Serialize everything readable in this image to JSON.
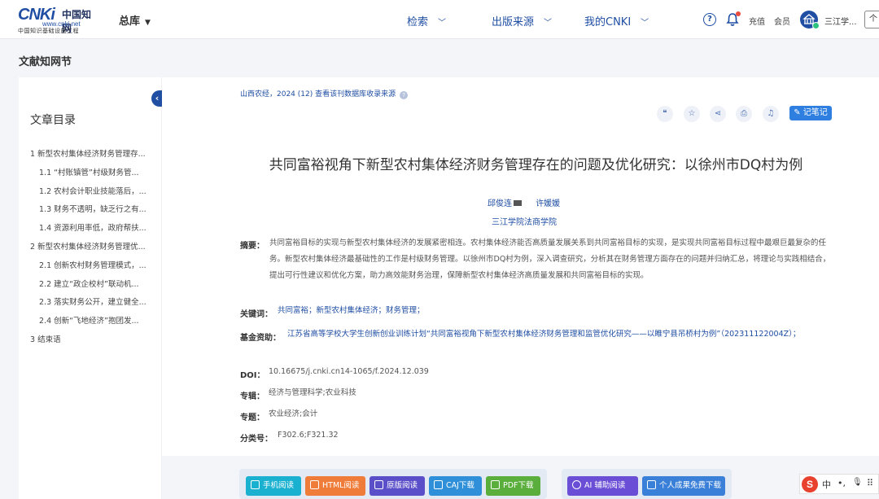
{
  "header": {
    "logo_text": "CNKi",
    "logo_cn": "中国知网",
    "logo_url": "www.cnki.net",
    "logo_sub": "中国知识基础设施工程",
    "zongku": "总库",
    "nav": [
      "检索",
      "出版来源",
      "我的CNKI"
    ],
    "help": "?",
    "recharge": "充值",
    "member": "会员",
    "username": "三江学...",
    "box": "个"
  },
  "section_title": "文献知网节",
  "toc": {
    "title": "文章目录",
    "items": [
      {
        "label": "1 新型农村集体经济财务管理存...",
        "level": 1
      },
      {
        "label": "1.1 “村账镇管”村级财务管...",
        "level": 2
      },
      {
        "label": "1.2 农村会计职业技能落后，...",
        "level": 2
      },
      {
        "label": "1.3 财务不透明，缺乏行之有...",
        "level": 2
      },
      {
        "label": "1.4 资源利用率低，政府帮扶...",
        "level": 2
      },
      {
        "label": "2 新型农村集体经济财务管理优...",
        "level": 1
      },
      {
        "label": "2.1 创新农村财务管理模式，...",
        "level": 2
      },
      {
        "label": "2.2 建立“政企校村”联动机...",
        "level": 2
      },
      {
        "label": "2.3 落实财务公开，建立健全...",
        "level": 2
      },
      {
        "label": "2.4 创新“飞地经济”抱团发...",
        "level": 2
      },
      {
        "label": "3 结束语",
        "level": 1
      }
    ]
  },
  "article": {
    "source": "山西农经，2024 (12)  查看该刊数据库收录来源",
    "note_button": "记笔记",
    "title": "共同富裕视角下新型农村集体经济财务管理存在的问题及优化研究：以徐州市DQ村为例",
    "author1": "邱俊连",
    "author2": "许媛媛",
    "affiliation": "三江学院法商学院",
    "abstract_label": "摘要：",
    "abstract": "共同富裕目标的实现与新型农村集体经济的发展紧密相连。农村集体经济能否高质量发展关系到共同富裕目标的实现，是实现共同富裕目标过程中最艰巨最复杂的任务。新型农村集体经济最基础性的工作是村级财务管理。以徐州市DQ村为例，深入调查研究，分析其在财务管理方面存在的问题并归纳汇总，将理论与实践相结合，提出可行性建议和优化方案，助力高效能财务治理，保障新型农村集体经济高质量发展和共同富裕目标的实现。",
    "keywords_label": "关键词：",
    "keywords": "共同富裕；新型农村集体经济；财务管理；",
    "fund_label": "基金资助：",
    "fund": "江苏省高等学校大学生创新创业训练计划“共同富裕视角下新型农村集体经济财务管理和监管优化研究——以睢宁县吊桥村为例”（202311122004Z）；",
    "doi_label": "DOI：",
    "doi": "10.16675/j.cnki.cn14-1065/f.2024.12.039",
    "series_label": "专辑：",
    "series": "经济与管理科学;农业科技",
    "topic_label": "专题：",
    "topic": "农业经济;会计",
    "class_label": "分类号：",
    "class": "F302.6;F321.32"
  },
  "actions": {
    "mobile": "手机阅读",
    "html": "HTML阅读",
    "original": "原版阅读",
    "caj": "CAJ下载",
    "pdf": "PDF下载",
    "ai": "AI 辅助阅读",
    "personal": "个人成果免费下载"
  },
  "ime": {
    "logo": "S",
    "lang": "中",
    "punct": "•,",
    "mic": "🎙",
    "more": "⠿"
  },
  "colors": {
    "brand": "#1f4ea3",
    "note": "#2f7fe0",
    "mobile": "#1ab0d0",
    "html": "#f07c3a",
    "original": "#5b4fc9",
    "caj": "#2f8fd8",
    "pdf": "#5aae3c",
    "ai": "#6a4fd6",
    "personal": "#3a7fd8"
  }
}
